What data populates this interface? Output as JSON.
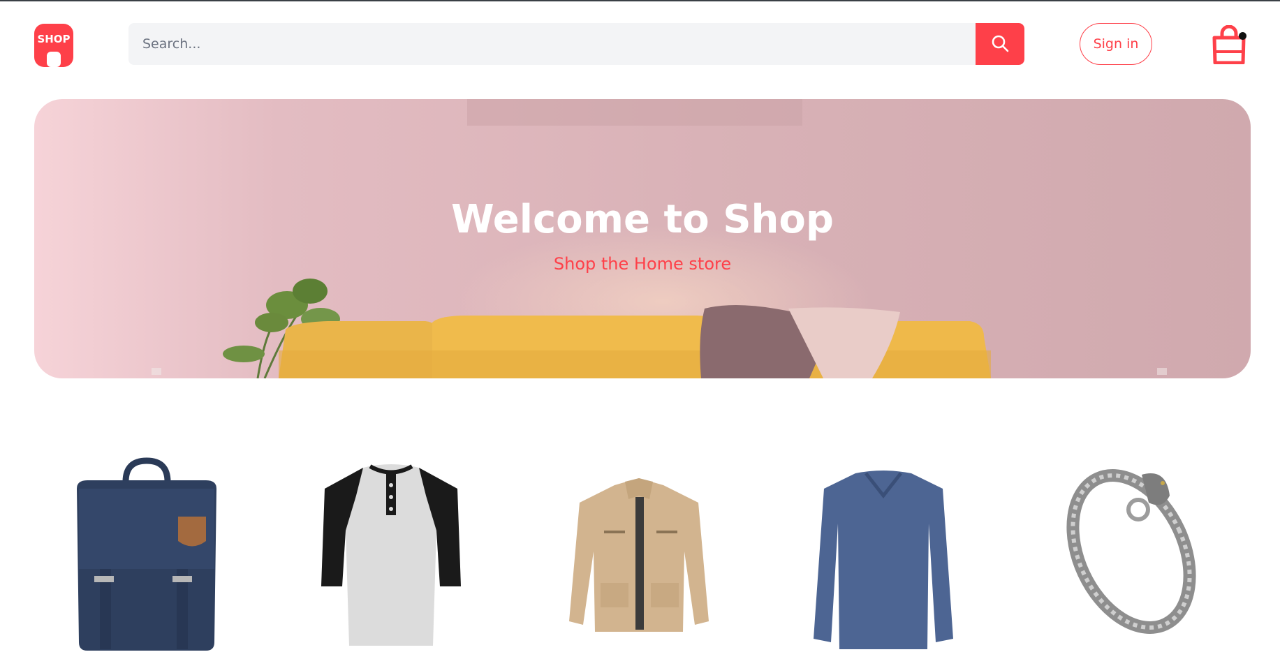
{
  "header": {
    "logo_text": "SHOP",
    "search": {
      "placeholder": "Search..."
    },
    "signin_label": "Sign in"
  },
  "hero": {
    "title": "Welcome to Shop",
    "subtitle": "Shop the Home store"
  },
  "products": [
    {
      "name": "backpack"
    },
    {
      "name": "henley-shirt"
    },
    {
      "name": "jacket"
    },
    {
      "name": "long-sleeve-shirt"
    },
    {
      "name": "bracelet"
    }
  ],
  "colors": {
    "accent": "#fe4049",
    "search_bg": "#f3f4f6",
    "hero_bg": "#d9b2b7"
  }
}
